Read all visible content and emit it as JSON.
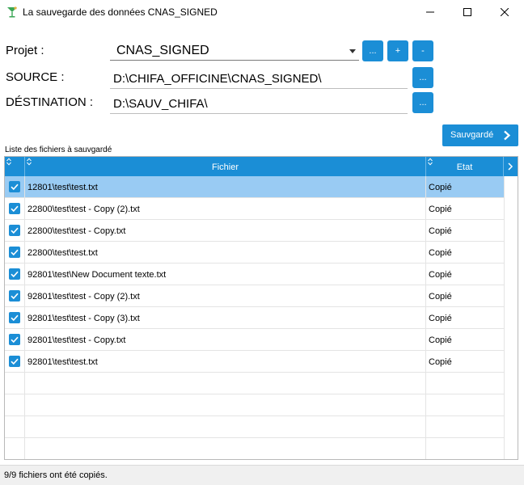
{
  "window": {
    "title": "La sauvegarde des données CNAS_SIGNED",
    "app_icon": "cocktail-glass-icon",
    "controls": [
      "minimize-icon",
      "maximize-icon",
      "close-icon"
    ]
  },
  "form": {
    "projet_label": "Projet :",
    "projet_value": "CNAS_SIGNED",
    "source_label": "SOURCE :",
    "source_value": "D:\\CHIFA_OFFICINE\\CNAS_SIGNED\\",
    "destination_label": "DÉSTINATION :",
    "destination_value": "D:\\SAUV_CHIFA\\",
    "browse_label": "...",
    "add_label": "+",
    "remove_label": "-"
  },
  "actions": {
    "save_label": "Sauvgardé",
    "save_icon": "chevron-right-icon"
  },
  "list": {
    "caption": "Liste des fichiers à sauvgardé",
    "columns": {
      "fichier": "Fichier",
      "etat": "Etat"
    },
    "rows": [
      {
        "file": "12801\\test\\test.txt",
        "status": "Copié",
        "checked": true,
        "selected": true
      },
      {
        "file": "22800\\test\\test - Copy (2).txt",
        "status": "Copié",
        "checked": true,
        "selected": false
      },
      {
        "file": "22800\\test\\test - Copy.txt",
        "status": "Copié",
        "checked": true,
        "selected": false
      },
      {
        "file": "22800\\test\\test.txt",
        "status": "Copié",
        "checked": true,
        "selected": false
      },
      {
        "file": "92801\\test\\New Document texte.txt",
        "status": "Copié",
        "checked": true,
        "selected": false
      },
      {
        "file": "92801\\test\\test - Copy (2).txt",
        "status": "Copié",
        "checked": true,
        "selected": false
      },
      {
        "file": "92801\\test\\test - Copy (3).txt",
        "status": "Copié",
        "checked": true,
        "selected": false
      },
      {
        "file": "92801\\test\\test - Copy.txt",
        "status": "Copié",
        "checked": true,
        "selected": false
      },
      {
        "file": "92801\\test\\test.txt",
        "status": "Copié",
        "checked": true,
        "selected": false
      }
    ]
  },
  "status_bar": {
    "text": "9/9 fichiers ont été copiés."
  },
  "colors": {
    "accent": "#1b8ed6",
    "selected_row": "#99cbf3"
  }
}
